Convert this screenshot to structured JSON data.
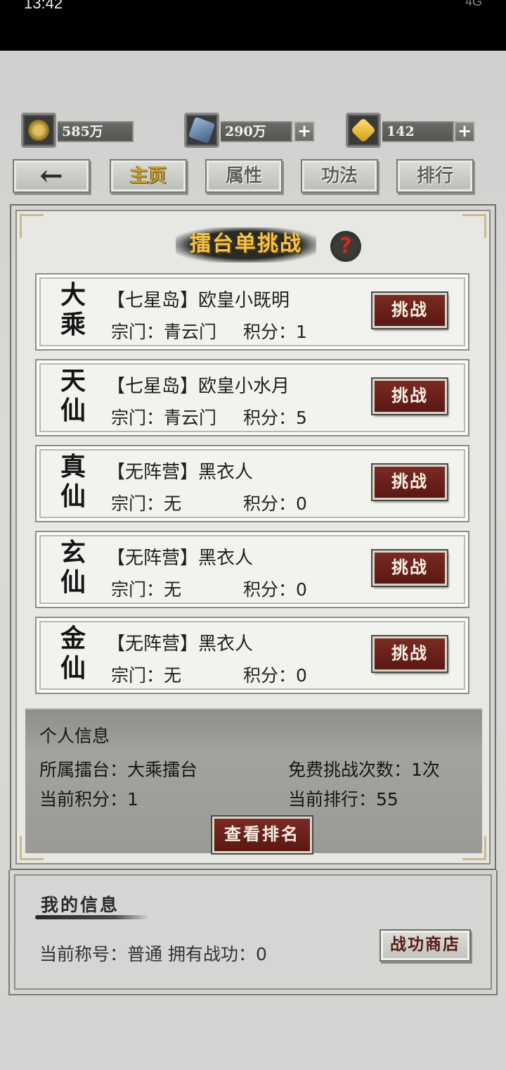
{
  "status": {
    "time": "13:42",
    "signal": "4G"
  },
  "resources": [
    {
      "icon": "yin-yang-coin-icon",
      "value": "585万",
      "has_plus": false
    },
    {
      "icon": "blue-crystal-icon",
      "value": "290万",
      "has_plus": true
    },
    {
      "icon": "gold-gem-icon",
      "value": "142",
      "has_plus": true
    }
  ],
  "nav": {
    "back_icon": "back-arrow-icon",
    "tabs": [
      {
        "label": "主页",
        "active": true
      },
      {
        "label": "属性",
        "active": false
      },
      {
        "label": "功法",
        "active": false
      },
      {
        "label": "排行",
        "active": false
      }
    ]
  },
  "panel": {
    "title": "擂台单挑战",
    "help": "?",
    "rows": [
      {
        "rank": "大乘",
        "name": "【七星岛】欧皇小既明",
        "sect": "宗门：青云门",
        "score": "积分：1",
        "button": "挑战"
      },
      {
        "rank": "天仙",
        "name": "【七星岛】欧皇小水月",
        "sect": "宗门：青云门",
        "score": "积分：5",
        "button": "挑战"
      },
      {
        "rank": "真仙",
        "name": "【无阵营】黑衣人",
        "sect": "宗门：无",
        "score": "积分：0",
        "button": "挑战"
      },
      {
        "rank": "玄仙",
        "name": "【无阵营】黑衣人",
        "sect": "宗门：无",
        "score": "积分：0",
        "button": "挑战"
      },
      {
        "rank": "金仙",
        "name": "【无阵营】黑衣人",
        "sect": "宗门：无",
        "score": "积分：0",
        "button": "挑战"
      }
    ]
  },
  "personal": {
    "heading": "个人信息",
    "arena": "所属擂台：大乘擂台",
    "free_challenges": "免费挑战次数：1次",
    "current_score": "当前积分：1",
    "current_rank": "当前排行：55",
    "view_rank_button": "查看排名"
  },
  "myinfo": {
    "heading": "我的信息",
    "line": "当前称号：普通   拥有战功：0",
    "shop_button": "战功商店"
  },
  "colors": {
    "accent_gold": "#f2c34a",
    "button_red": "#6a1f18"
  }
}
